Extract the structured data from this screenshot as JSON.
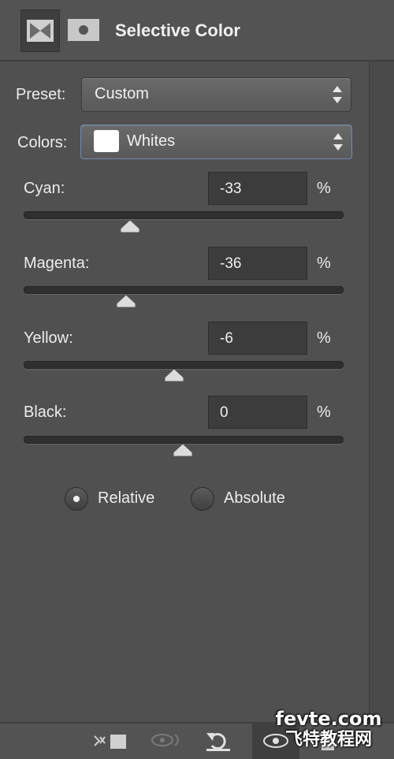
{
  "header": {
    "title": "Selective Color",
    "icons": [
      "adjustment-icon",
      "layer-mask-icon"
    ]
  },
  "preset": {
    "label": "Preset:",
    "value": "Custom"
  },
  "colors": {
    "label": "Colors:",
    "value": "Whites",
    "swatch_color": "#ffffff"
  },
  "sliders": [
    {
      "label": "Cyan:",
      "value": "-33",
      "unit": "%",
      "position": -33
    },
    {
      "label": "Magenta:",
      "value": "-36",
      "unit": "%",
      "position": -36
    },
    {
      "label": "Yellow:",
      "value": "-6",
      "unit": "%",
      "position": -6
    },
    {
      "label": "Black:",
      "value": "0",
      "unit": "%",
      "position": 0
    }
  ],
  "method": {
    "relative_label": "Relative",
    "absolute_label": "Absolute",
    "selected": "relative"
  },
  "footer": {
    "icons": [
      "clip-to-layer-icon",
      "view-previous-state-icon",
      "reset-icon",
      "visibility-eye-icon",
      "delete-icon"
    ]
  },
  "watermark": {
    "line1": "fevte.com",
    "line2": "飞特教程网"
  }
}
